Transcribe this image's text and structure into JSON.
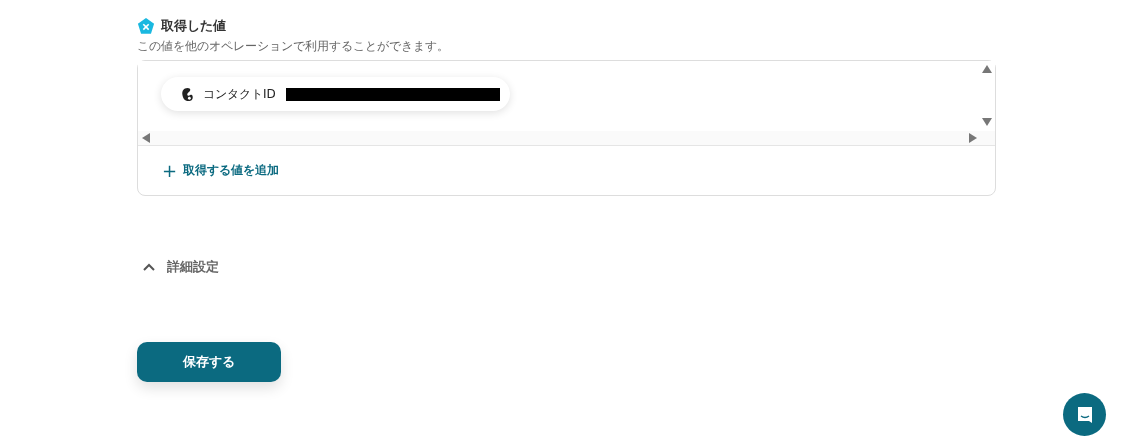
{
  "section": {
    "title": "取得した値",
    "description": "この値を他のオペレーションで利用することができます。"
  },
  "values": [
    {
      "label": "コンタクトID",
      "redacted": true
    }
  ],
  "add_button": {
    "icon": "+",
    "label": "取得する値を追加"
  },
  "advanced": {
    "label": "詳細設定",
    "expanded": true
  },
  "save_button": {
    "label": "保存する"
  }
}
